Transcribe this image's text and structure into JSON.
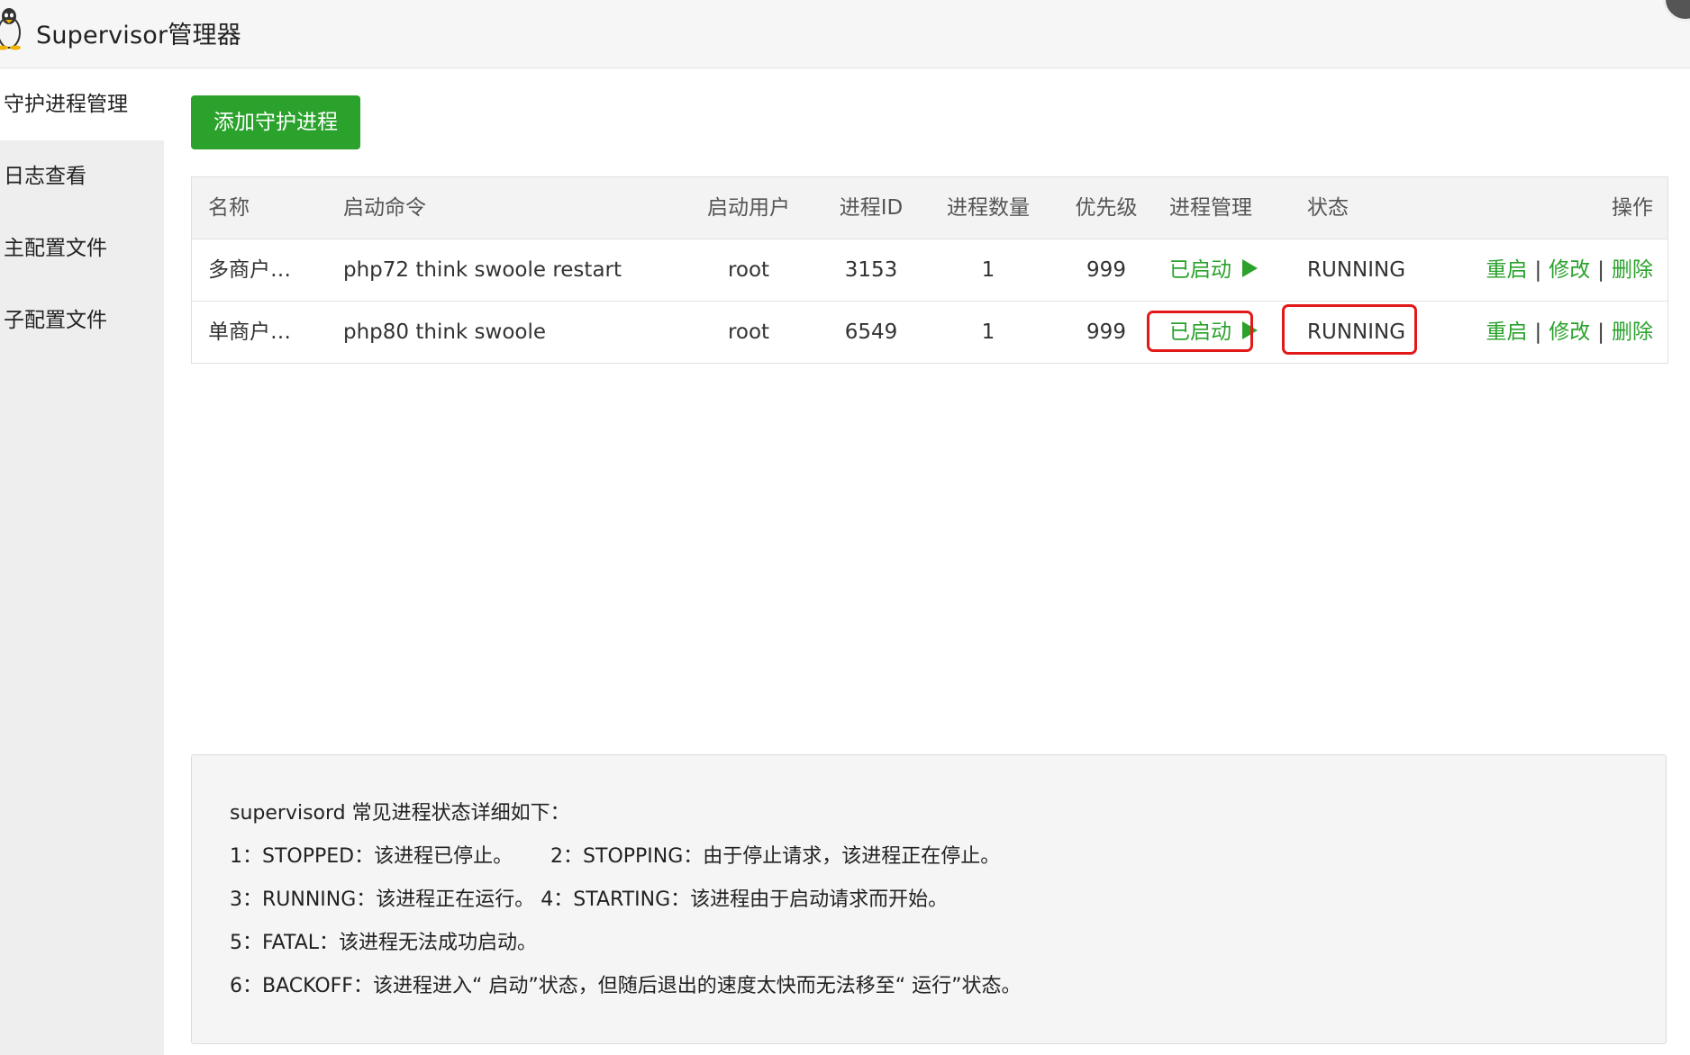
{
  "app": {
    "title": "Supervisor管理器",
    "logo_icon": "penguin-icon"
  },
  "sidebar": {
    "items": [
      {
        "label": "守护进程管理",
        "active": true
      },
      {
        "label": "日志查看",
        "active": false
      },
      {
        "label": "主配置文件",
        "active": false
      },
      {
        "label": "子配置文件",
        "active": false
      }
    ]
  },
  "toolbar": {
    "add_label": "添加守护进程"
  },
  "table": {
    "headers": {
      "name": "名称",
      "command": "启动命令",
      "user": "启动用户",
      "pid": "进程ID",
      "count": "进程数量",
      "priority": "优先级",
      "manage": "进程管理",
      "status": "状态",
      "ops": "操作"
    },
    "rows": [
      {
        "name": "多商户…",
        "command": "php72 think swoole restart",
        "user": "root",
        "pid": "3153",
        "count": "1",
        "priority": "999",
        "manage": "已启动",
        "status": "RUNNING",
        "restart": "重启",
        "edit": "修改",
        "delete": "删除",
        "sep": "|"
      },
      {
        "name": "单商户…",
        "command": "php80 think swoole",
        "user": "root",
        "pid": "6549",
        "count": "1",
        "priority": "999",
        "manage": "已启动",
        "status": "RUNNING",
        "restart": "重启",
        "edit": "修改",
        "delete": "删除",
        "sep": "|"
      }
    ]
  },
  "info": {
    "lines": [
      "supervisord 常见进程状态详细如下：",
      "1：STOPPED：该进程已停止。      2：STOPPING：由于停止请求，该进程正在停止。",
      "3：RUNNING：该进程正在运行。 4：STARTING：该进程由于启动请求而开始。",
      "5：FATAL：该进程无法成功启动。",
      "6：BACKOFF：该进程进入“ 启动”状态，但随后退出的速度太快而无法移至“ 运行”状态。"
    ]
  },
  "colors": {
    "accent": "#2aa22c",
    "highlight": "#e21919"
  }
}
